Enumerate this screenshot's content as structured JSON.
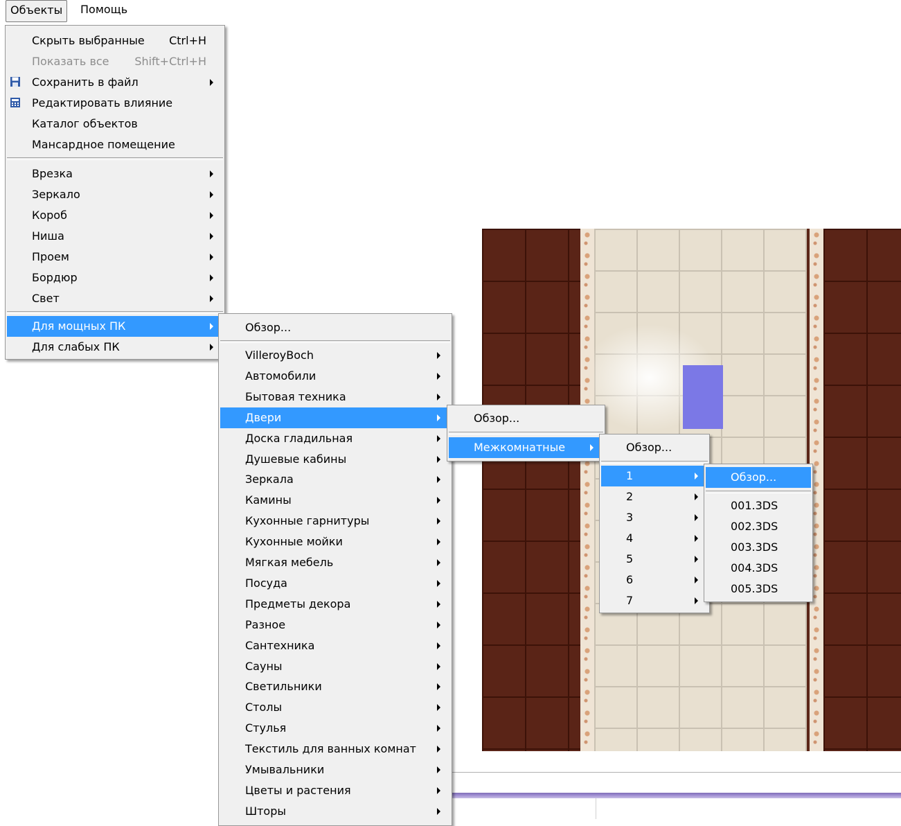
{
  "menubar": {
    "objects": "Объекты",
    "help": "Помощь"
  },
  "objects_menu": {
    "hide_selected": "Скрыть выбранные",
    "hide_selected_shortcut": "Ctrl+H",
    "show_all": "Показать все",
    "show_all_shortcut": "Shift+Ctrl+H",
    "save_to_file": "Сохранить в файл",
    "edit_influence": "Редактировать влияние",
    "catalog": "Каталог объектов",
    "mansard": "Мансардное помещение",
    "insert": "Врезка",
    "mirror": "Зеркало",
    "box": "Короб",
    "niche": "Ниша",
    "opening": "Проем",
    "border": "Бордюр",
    "light": "Свет",
    "powerful_pc": "Для мощных ПК",
    "weak_pc": "Для слабых ПК"
  },
  "catalog_menu": {
    "browse": "Обзор...",
    "items": [
      "VilleroyBoch",
      "Автомобили",
      "Бытовая техника",
      "Двери",
      "Доска гладильная",
      "Душевые кабины",
      "Зеркала",
      "Камины",
      "Кухонные гарнитуры",
      "Кухонные мойки",
      "Мягкая мебель",
      "Посуда",
      "Предметы декора",
      "Разное",
      "Сантехника",
      "Сауны",
      "Светильники",
      "Столы",
      "Стулья",
      "Текстиль для ванных комнат",
      "Умывальники",
      "Цветы и растения",
      "Шторы"
    ]
  },
  "doors_menu": {
    "browse": "Обзор...",
    "interior": "Межкомнатные"
  },
  "interior_menu": {
    "browse": "Обзор...",
    "items": [
      "1",
      "2",
      "3",
      "4",
      "5",
      "6",
      "7"
    ]
  },
  "files_menu": {
    "browse": "Обзор...",
    "items": [
      "001.3DS",
      "002.3DS",
      "003.3DS",
      "004.3DS",
      "005.3DS"
    ]
  },
  "icons": {
    "save": "floppy-disk-icon",
    "influence": "calculator-icon"
  },
  "colors": {
    "highlight": "#3399ff",
    "menu_bg": "#f0f0f0",
    "tile_wall": "#5a2417",
    "selection": "#7b78e6"
  }
}
